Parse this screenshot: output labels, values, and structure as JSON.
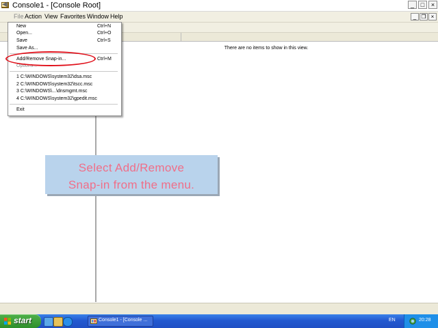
{
  "window": {
    "title": "Console1 - [Console Root]",
    "controls": {
      "minimize": "_",
      "maximize": "□",
      "close": "×"
    }
  },
  "menubar": {
    "items": [
      "File",
      "Action",
      "View",
      "Favorites",
      "Window",
      "Help"
    ],
    "mdi_controls": {
      "minimize": "_",
      "restore": "❐",
      "close": "×"
    }
  },
  "file_menu": {
    "items": [
      {
        "label": "New",
        "shortcut": "Ctrl+N"
      },
      {
        "label": "Open...",
        "shortcut": "Ctrl+O"
      },
      {
        "label": "Save",
        "shortcut": "Ctrl+S"
      },
      {
        "label": "Save As...",
        "shortcut": ""
      },
      {
        "label": "Add/Remove Snap-in...",
        "shortcut": "Ctrl+M"
      },
      {
        "label": "Options...",
        "shortcut": ""
      },
      {
        "label": "1 C:\\WINDOWS\\system32\\dsa.msc",
        "shortcut": ""
      },
      {
        "label": "2 C:\\WINDOWS\\system32\\tscc.msc",
        "shortcut": ""
      },
      {
        "label": "3 C:\\WINDOWS\\...\\dnsmgmt.msc",
        "shortcut": ""
      },
      {
        "label": "4 C:\\WINDOWS\\system32\\gpedit.msc",
        "shortcut": ""
      },
      {
        "label": "Exit",
        "shortcut": ""
      }
    ]
  },
  "list_pane": {
    "empty_message": "There are no items to show in this view."
  },
  "callout": {
    "line1": "Select Add/Remove",
    "line2": "Snap-in from the menu."
  },
  "taskbar": {
    "start_label": "start",
    "task_label": "Console1 - [Console ...",
    "language": "EN",
    "clock": "20:28"
  },
  "colors": {
    "highlight_ellipse": "#e0101a",
    "callout_bg": "#b9d3ec",
    "callout_text": "#f06e88",
    "taskbar": "#2359d0",
    "start_button": "#3a9a35"
  },
  "icons": {
    "title": "mmc-console-icon",
    "back": "back-arrow-icon",
    "start": "windows-flag-icon",
    "quicklaunch": [
      "show-desktop-icon",
      "explorer-icon",
      "internet-explorer-icon"
    ],
    "task": "mmc-console-icon",
    "tray": "network-icon"
  }
}
